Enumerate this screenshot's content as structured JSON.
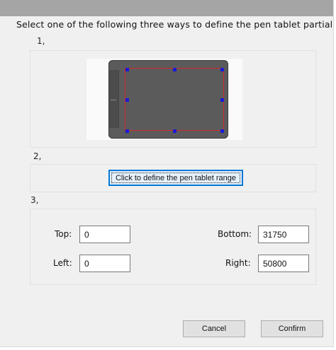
{
  "dialog": {
    "heading": "Select one of the following three ways to define the pen tablet partial"
  },
  "section1": {
    "label": "1,"
  },
  "section2": {
    "label": "2,",
    "define_button": "Click to define the pen tablet range"
  },
  "section3": {
    "label": "3,",
    "top": {
      "label": "Top:",
      "value": "0"
    },
    "left": {
      "label": "Left:",
      "value": "0"
    },
    "bottom": {
      "label": "Bottom:",
      "value": "31750"
    },
    "right": {
      "label": "Right:",
      "value": "50800"
    }
  },
  "footer": {
    "cancel_label": "Cancel",
    "confirm_label": "Confirm"
  },
  "colors": {
    "area_border": "#d3262c",
    "handle": "#1a1ad4",
    "focus_accent": "#0078d7"
  }
}
